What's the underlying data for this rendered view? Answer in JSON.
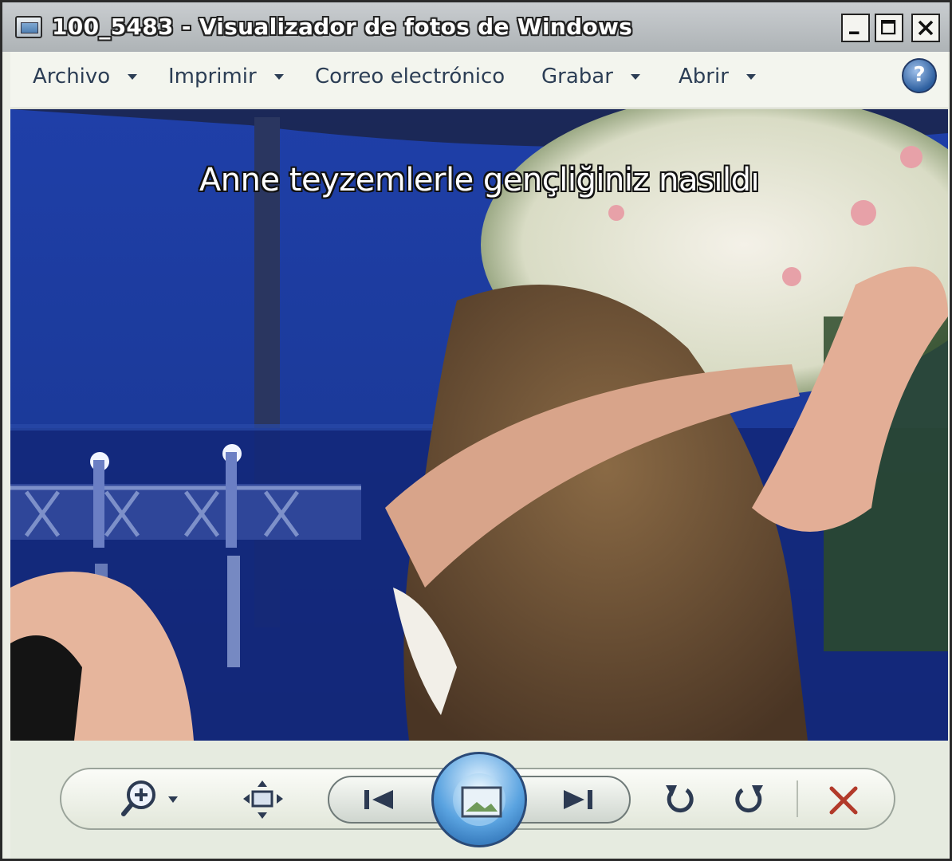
{
  "window": {
    "title": "100_5483 - Visualizador de fotos de Windows"
  },
  "menu": {
    "items": [
      {
        "label": "Archivo",
        "has_dropdown": true
      },
      {
        "label": "Imprimir",
        "has_dropdown": true
      },
      {
        "label": "Correo electrónico",
        "has_dropdown": false
      },
      {
        "label": "Grabar",
        "has_dropdown": true
      },
      {
        "label": "Abrir",
        "has_dropdown": true
      }
    ],
    "help_label": "?"
  },
  "photo": {
    "caption": "Anne teyzemlerle gençliğiniz nasıldı"
  },
  "toolbar": {
    "icons": [
      "zoom-icon",
      "fit-window-icon",
      "previous-icon",
      "slideshow-icon",
      "next-icon",
      "rotate-left-icon",
      "rotate-right-icon",
      "delete-icon"
    ]
  },
  "colors": {
    "accent_blue": "#3b78c4",
    "delete_red": "#b23a2a"
  }
}
